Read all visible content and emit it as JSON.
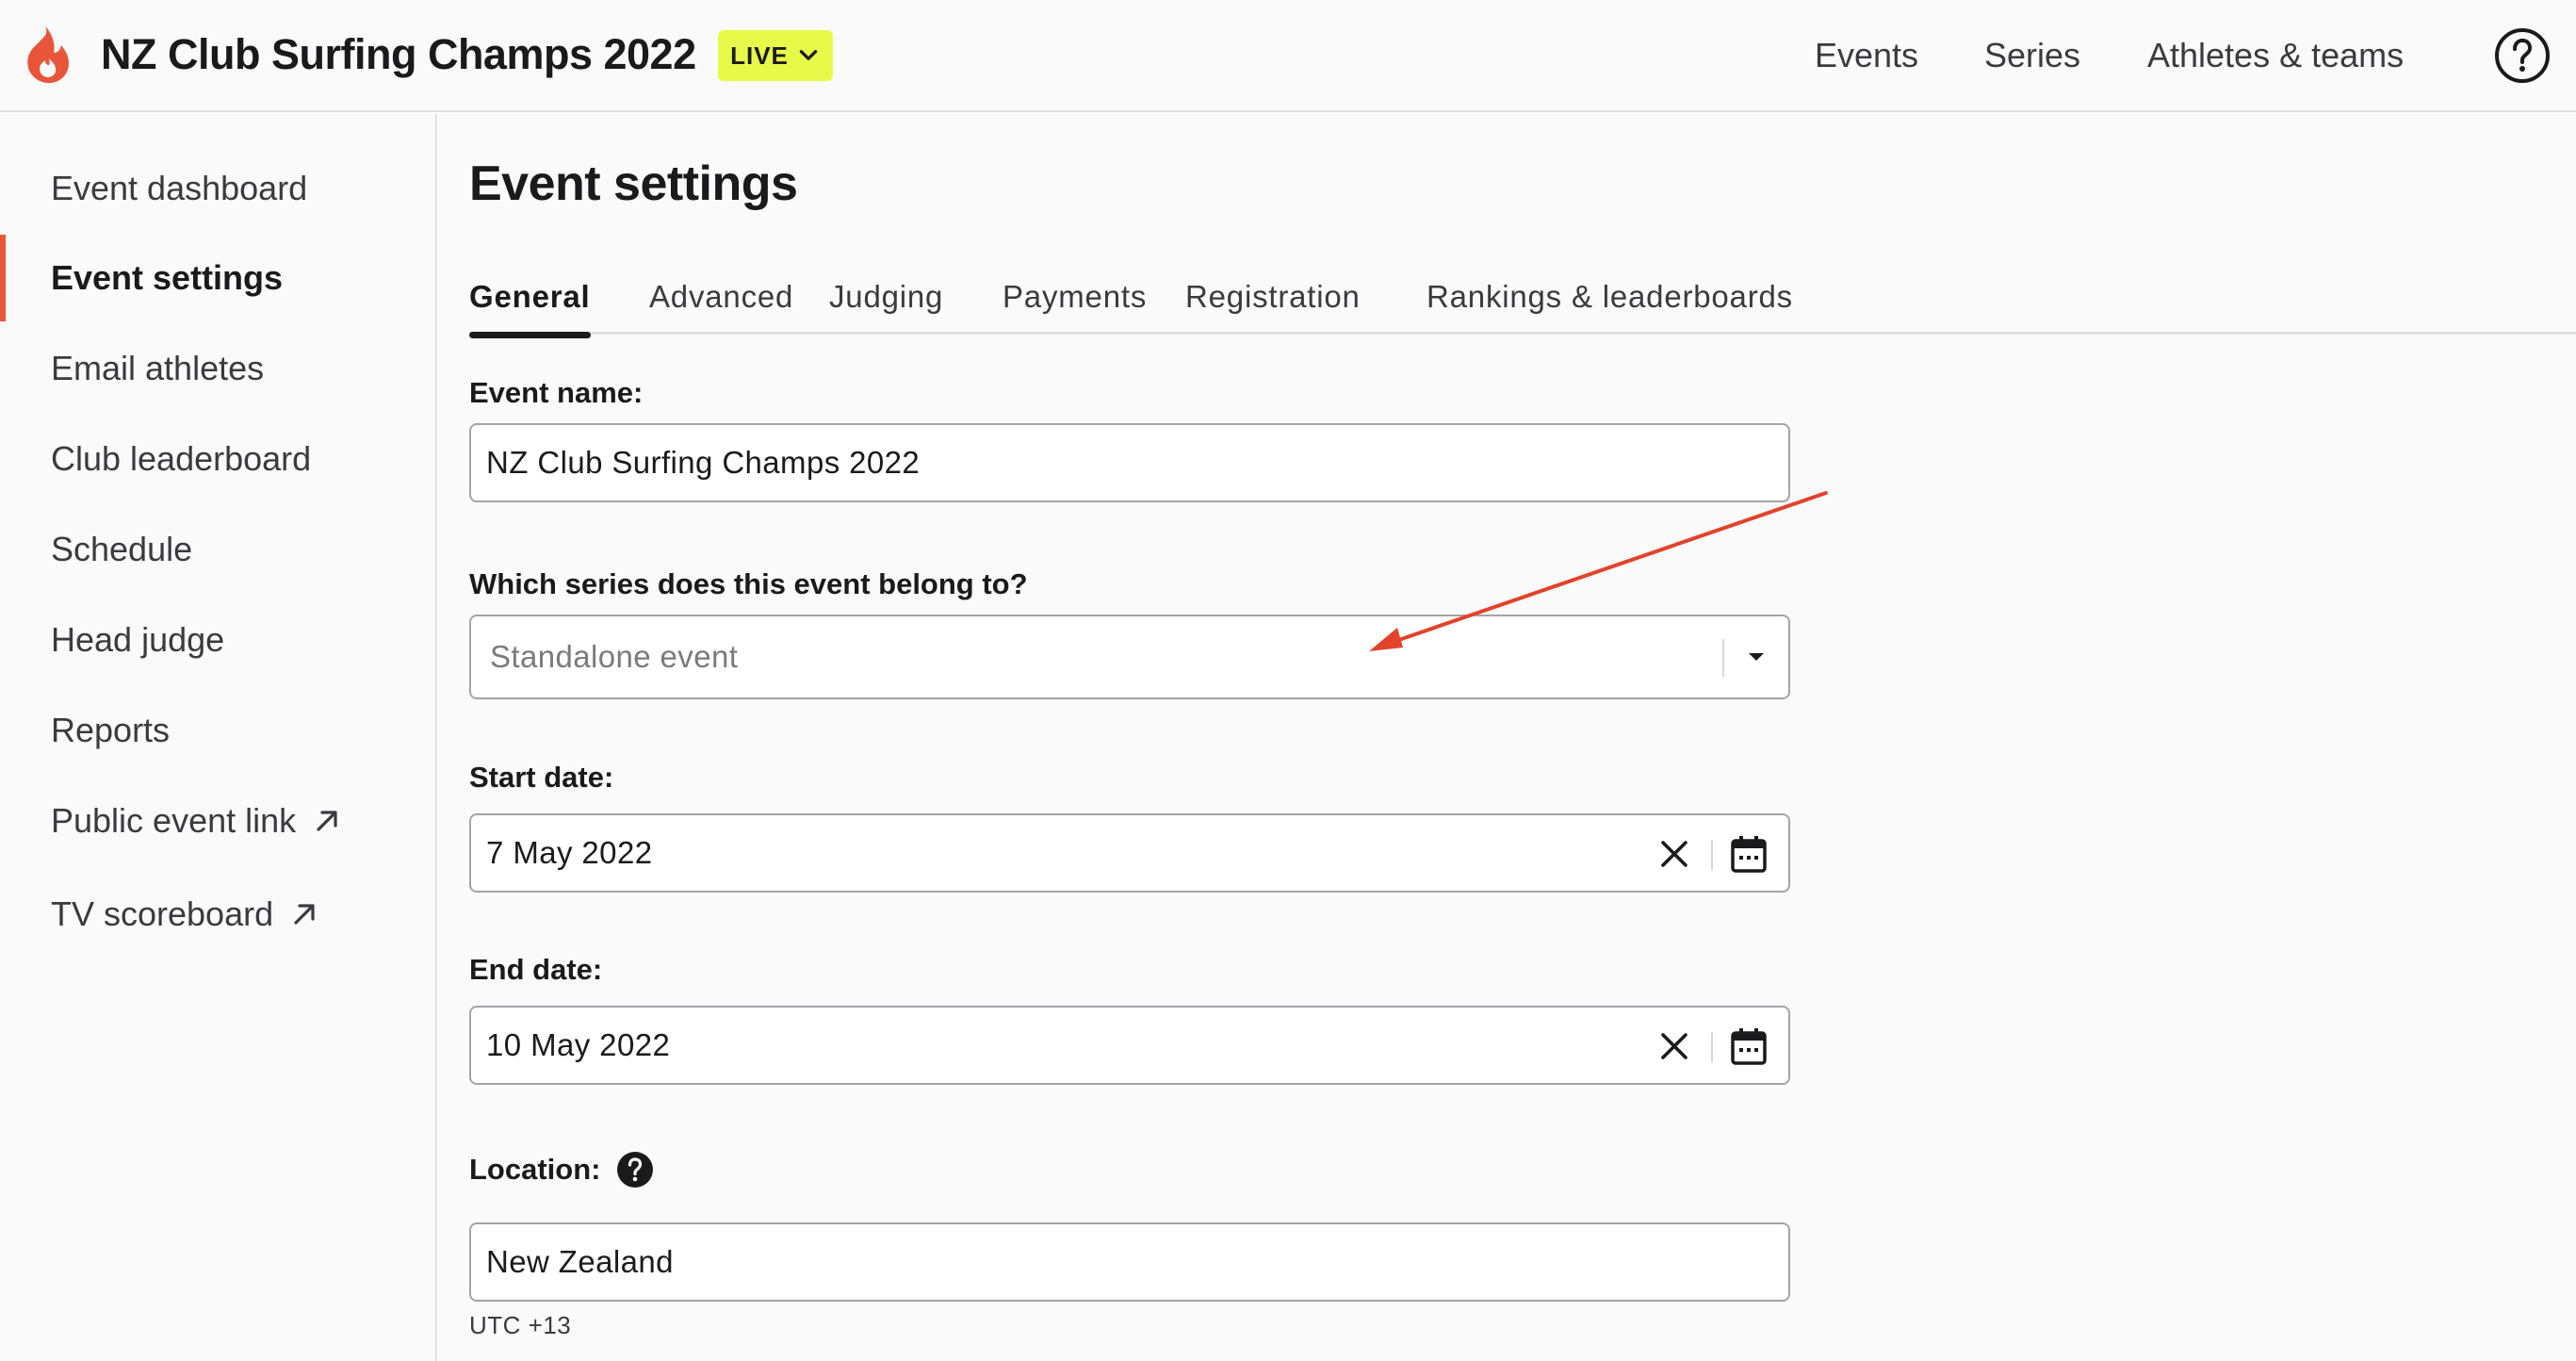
{
  "header": {
    "title": "NZ Club Surfing Champs 2022",
    "status_badge": "LIVE",
    "nav": [
      "Events",
      "Series",
      "Athletes & teams"
    ],
    "help_icon": "question-circle-icon",
    "logo_icon": "flame-logo-icon"
  },
  "sidebar": {
    "items": [
      {
        "label": "Event dashboard"
      },
      {
        "label": "Event settings",
        "active": true
      },
      {
        "label": "Email athletes"
      },
      {
        "label": "Club leaderboard"
      },
      {
        "label": "Schedule"
      },
      {
        "label": "Head judge"
      },
      {
        "label": "Reports"
      },
      {
        "label": "Public event link",
        "icon": "external-link-icon"
      },
      {
        "label": "TV scoreboard",
        "icon": "external-link-icon"
      }
    ]
  },
  "main": {
    "title": "Event settings",
    "tabs": [
      {
        "label": "General",
        "active": true
      },
      {
        "label": "Advanced"
      },
      {
        "label": "Judging"
      },
      {
        "label": "Payments"
      },
      {
        "label": "Registration"
      },
      {
        "label": "Rankings & leaderboards"
      }
    ],
    "form": {
      "event_name": {
        "label": "Event name:",
        "value": "NZ Club Surfing Champs 2022"
      },
      "series": {
        "label": "Which series does this event belong to?",
        "placeholder": "Standalone event"
      },
      "start_date": {
        "label": "Start date:",
        "value": "7 May 2022"
      },
      "end_date": {
        "label": "End date:",
        "value": "10 May 2022"
      },
      "location": {
        "label": "Location:",
        "value": "New Zealand",
        "hint": "UTC +13"
      }
    }
  },
  "colors": {
    "accent": "#e8553b",
    "live_badge": "#e7fa4a",
    "annotation_arrow": "#e2432a"
  }
}
